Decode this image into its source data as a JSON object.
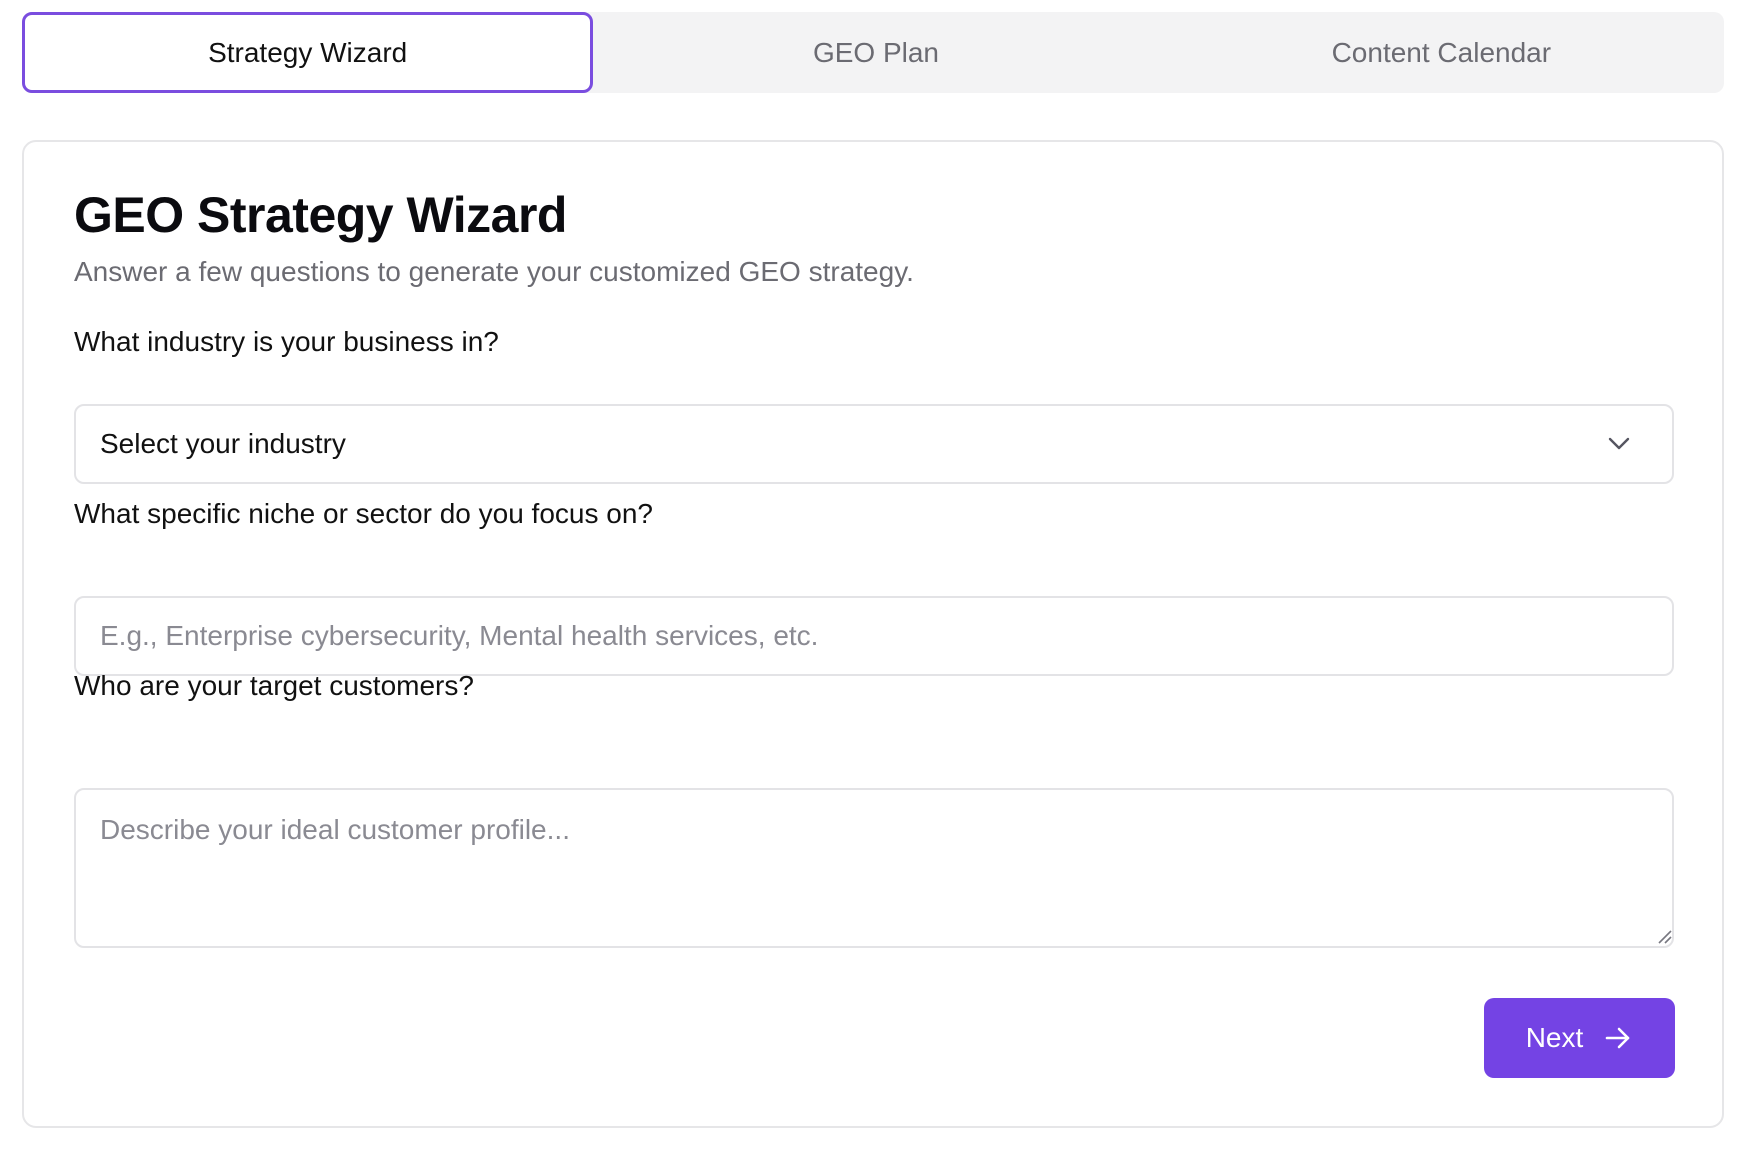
{
  "tabs": [
    {
      "label": "Strategy Wizard",
      "active": true
    },
    {
      "label": "GEO Plan",
      "active": false
    },
    {
      "label": "Content Calendar",
      "active": false
    }
  ],
  "wizard": {
    "title": "GEO Strategy Wizard",
    "subtitle": "Answer a few questions to generate your customized GEO strategy.",
    "industry": {
      "label": "What industry is your business in?",
      "selected_value": "Select your industry",
      "icon": "chevron-down-icon"
    },
    "niche": {
      "label": "What specific niche or sector do you focus on?",
      "placeholder": "E.g., Enterprise cybersecurity, Mental health services, etc.",
      "value": ""
    },
    "customers": {
      "label": "Who are your target customers?",
      "placeholder": "Describe your ideal customer profile...",
      "value": ""
    },
    "next_button": {
      "label": "Next",
      "icon": "arrow-right-icon"
    }
  },
  "colors": {
    "accent": "#7443e4",
    "active_tab_border": "#7a4ddf",
    "tab_bar_bg": "#f3f3f4",
    "muted_text": "#6b6b72",
    "border": "#e3e3e6"
  }
}
